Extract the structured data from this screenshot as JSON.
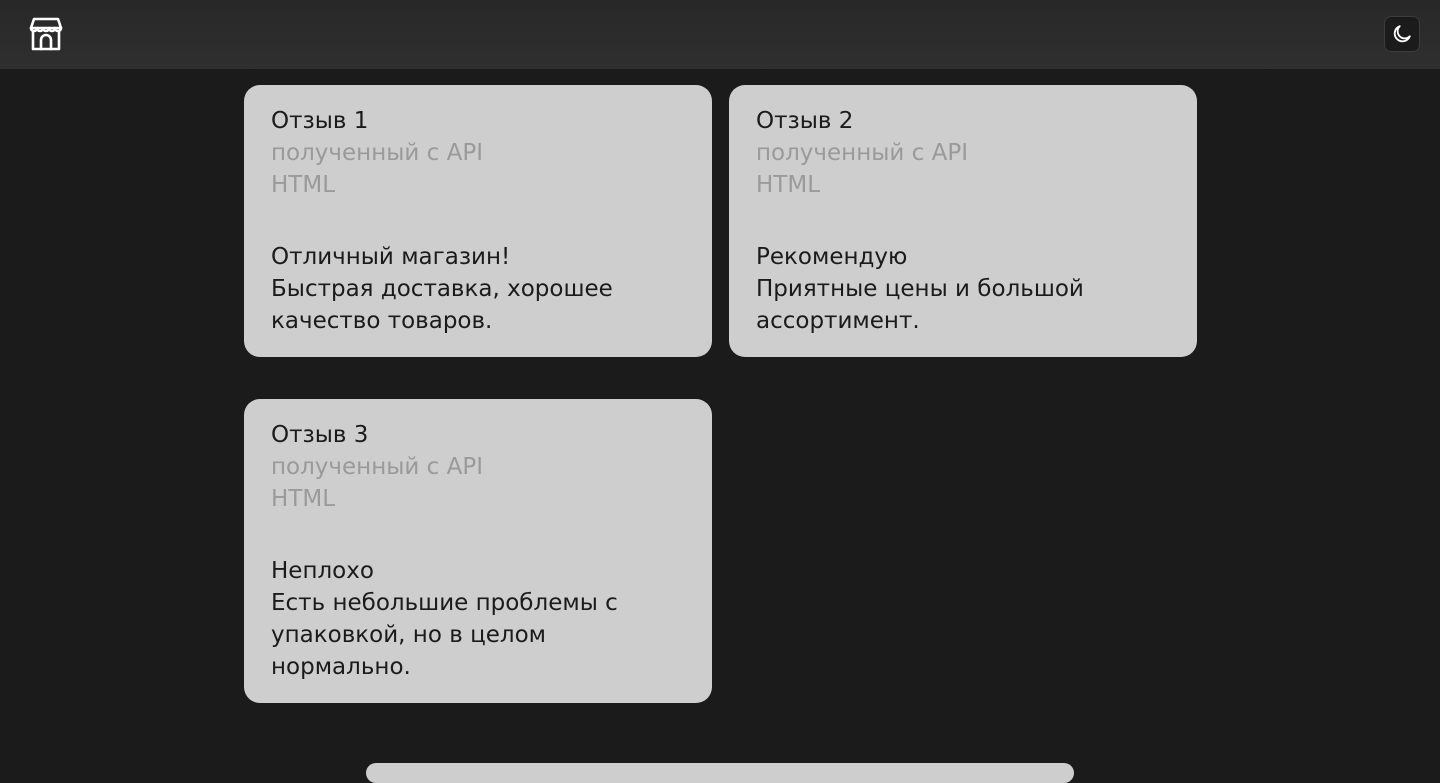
{
  "header": {
    "logo_icon": "store-icon",
    "theme_toggle_icon": "moon-icon"
  },
  "reviews": [
    {
      "title": "Отзыв 1",
      "source": "полученный с API",
      "format": "HTML",
      "headline": "Отличный магазин!",
      "text": "Быстрая доставка, хорошее качество товаров."
    },
    {
      "title": "Отзыв 2",
      "source": "полученный с API",
      "format": "HTML",
      "headline": "Рекомендую",
      "text": "Приятные цены и большой ассортимент."
    },
    {
      "title": "Отзыв 3",
      "source": "полученный с API",
      "format": "HTML",
      "headline": "Неплохо",
      "text": "Есть небольшие проблемы с упаковкой, но в целом нормально."
    }
  ],
  "colors": {
    "background": "#1b1b1b",
    "header": "#2f2f2f",
    "card": "#cecece",
    "muted_text": "#9a9a9a"
  }
}
